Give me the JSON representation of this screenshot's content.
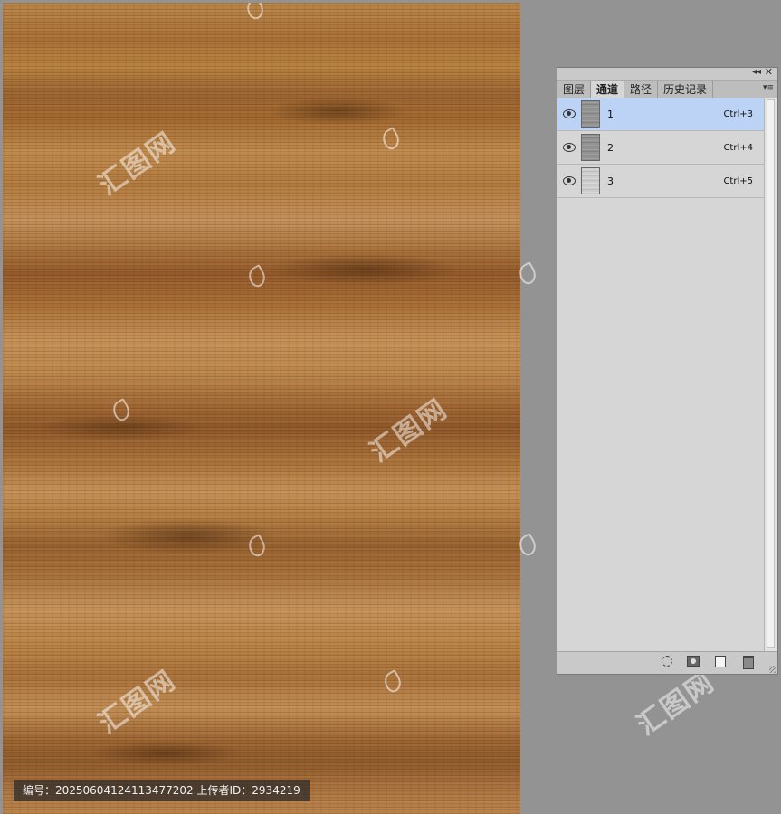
{
  "panel": {
    "tabs": [
      {
        "label": "图层",
        "active": false
      },
      {
        "label": "通道",
        "active": true
      },
      {
        "label": "路径",
        "active": false
      },
      {
        "label": "历史记录",
        "active": false
      }
    ],
    "collapse_glyph": "◂◂",
    "close_glyph": "✕",
    "menu_glyph": "▾≡",
    "channels": [
      {
        "name": "1",
        "shortcut": "Ctrl+3",
        "selected": true,
        "visible": true
      },
      {
        "name": "2",
        "shortcut": "Ctrl+4",
        "selected": false,
        "visible": true
      },
      {
        "name": "3",
        "shortcut": "Ctrl+5",
        "selected": false,
        "visible": true
      }
    ],
    "footer_icons": [
      "load-selection-icon",
      "save-selection-icon",
      "new-channel-icon",
      "delete-channel-icon"
    ]
  },
  "info": {
    "text": "编号：20250604124113477202   上传者ID：2934219"
  },
  "colors": {
    "workspace": "#939393",
    "panel_bg": "#d6d6d6",
    "selected_row": "#bcd3f5",
    "wood_base": "#b07a42"
  }
}
